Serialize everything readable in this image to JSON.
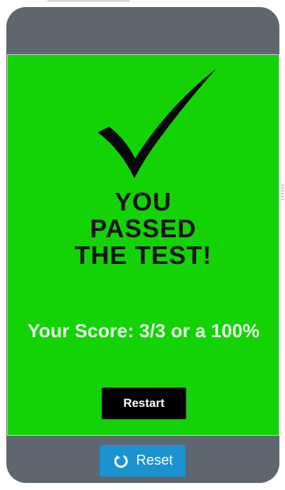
{
  "result": {
    "headline_line1": "YOU",
    "headline_line2": "PASSED",
    "headline_line3": "THE TEST!",
    "score_text": "Your Score: 3/3 or a 100%",
    "icon": "checkmark-icon"
  },
  "buttons": {
    "restart_label": "Restart",
    "reset_label": "Reset",
    "reset_icon": "refresh-icon"
  },
  "colors": {
    "success_background": "#13d305",
    "device_frame": "#5e6670",
    "reset_button": "#1a93d0",
    "restart_button": "#000000"
  }
}
